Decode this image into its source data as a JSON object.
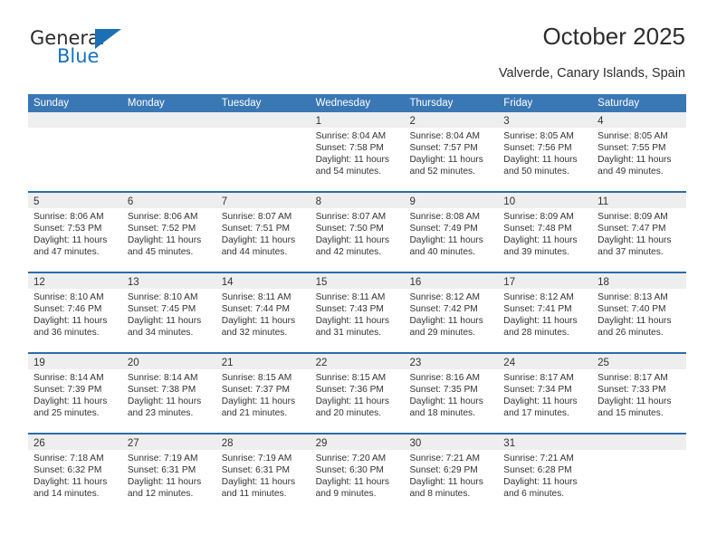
{
  "brand": {
    "name_part1": "General",
    "name_part2": "Blue",
    "flag_icon": "triangle-flag-icon",
    "accent_color": "#1673bb"
  },
  "header": {
    "title": "October 2025",
    "subtitle": "Valverde, Canary Islands, Spain"
  },
  "theme": {
    "header_blue": "#3a77b5",
    "rule_blue": "#2a6cab",
    "daynum_band": "#eeeeee"
  },
  "calendar": {
    "weekdays": [
      "Sunday",
      "Monday",
      "Tuesday",
      "Wednesday",
      "Thursday",
      "Friday",
      "Saturday"
    ],
    "weeks": [
      [
        {
          "day": "",
          "lines": []
        },
        {
          "day": "",
          "lines": []
        },
        {
          "day": "",
          "lines": []
        },
        {
          "day": "1",
          "lines": [
            "Sunrise: 8:04 AM",
            "Sunset: 7:58 PM",
            "Daylight: 11 hours",
            "and 54 minutes."
          ]
        },
        {
          "day": "2",
          "lines": [
            "Sunrise: 8:04 AM",
            "Sunset: 7:57 PM",
            "Daylight: 11 hours",
            "and 52 minutes."
          ]
        },
        {
          "day": "3",
          "lines": [
            "Sunrise: 8:05 AM",
            "Sunset: 7:56 PM",
            "Daylight: 11 hours",
            "and 50 minutes."
          ]
        },
        {
          "day": "4",
          "lines": [
            "Sunrise: 8:05 AM",
            "Sunset: 7:55 PM",
            "Daylight: 11 hours",
            "and 49 minutes."
          ]
        }
      ],
      [
        {
          "day": "5",
          "lines": [
            "Sunrise: 8:06 AM",
            "Sunset: 7:53 PM",
            "Daylight: 11 hours",
            "and 47 minutes."
          ]
        },
        {
          "day": "6",
          "lines": [
            "Sunrise: 8:06 AM",
            "Sunset: 7:52 PM",
            "Daylight: 11 hours",
            "and 45 minutes."
          ]
        },
        {
          "day": "7",
          "lines": [
            "Sunrise: 8:07 AM",
            "Sunset: 7:51 PM",
            "Daylight: 11 hours",
            "and 44 minutes."
          ]
        },
        {
          "day": "8",
          "lines": [
            "Sunrise: 8:07 AM",
            "Sunset: 7:50 PM",
            "Daylight: 11 hours",
            "and 42 minutes."
          ]
        },
        {
          "day": "9",
          "lines": [
            "Sunrise: 8:08 AM",
            "Sunset: 7:49 PM",
            "Daylight: 11 hours",
            "and 40 minutes."
          ]
        },
        {
          "day": "10",
          "lines": [
            "Sunrise: 8:09 AM",
            "Sunset: 7:48 PM",
            "Daylight: 11 hours",
            "and 39 minutes."
          ]
        },
        {
          "day": "11",
          "lines": [
            "Sunrise: 8:09 AM",
            "Sunset: 7:47 PM",
            "Daylight: 11 hours",
            "and 37 minutes."
          ]
        }
      ],
      [
        {
          "day": "12",
          "lines": [
            "Sunrise: 8:10 AM",
            "Sunset: 7:46 PM",
            "Daylight: 11 hours",
            "and 36 minutes."
          ]
        },
        {
          "day": "13",
          "lines": [
            "Sunrise: 8:10 AM",
            "Sunset: 7:45 PM",
            "Daylight: 11 hours",
            "and 34 minutes."
          ]
        },
        {
          "day": "14",
          "lines": [
            "Sunrise: 8:11 AM",
            "Sunset: 7:44 PM",
            "Daylight: 11 hours",
            "and 32 minutes."
          ]
        },
        {
          "day": "15",
          "lines": [
            "Sunrise: 8:11 AM",
            "Sunset: 7:43 PM",
            "Daylight: 11 hours",
            "and 31 minutes."
          ]
        },
        {
          "day": "16",
          "lines": [
            "Sunrise: 8:12 AM",
            "Sunset: 7:42 PM",
            "Daylight: 11 hours",
            "and 29 minutes."
          ]
        },
        {
          "day": "17",
          "lines": [
            "Sunrise: 8:12 AM",
            "Sunset: 7:41 PM",
            "Daylight: 11 hours",
            "and 28 minutes."
          ]
        },
        {
          "day": "18",
          "lines": [
            "Sunrise: 8:13 AM",
            "Sunset: 7:40 PM",
            "Daylight: 11 hours",
            "and 26 minutes."
          ]
        }
      ],
      [
        {
          "day": "19",
          "lines": [
            "Sunrise: 8:14 AM",
            "Sunset: 7:39 PM",
            "Daylight: 11 hours",
            "and 25 minutes."
          ]
        },
        {
          "day": "20",
          "lines": [
            "Sunrise: 8:14 AM",
            "Sunset: 7:38 PM",
            "Daylight: 11 hours",
            "and 23 minutes."
          ]
        },
        {
          "day": "21",
          "lines": [
            "Sunrise: 8:15 AM",
            "Sunset: 7:37 PM",
            "Daylight: 11 hours",
            "and 21 minutes."
          ]
        },
        {
          "day": "22",
          "lines": [
            "Sunrise: 8:15 AM",
            "Sunset: 7:36 PM",
            "Daylight: 11 hours",
            "and 20 minutes."
          ]
        },
        {
          "day": "23",
          "lines": [
            "Sunrise: 8:16 AM",
            "Sunset: 7:35 PM",
            "Daylight: 11 hours",
            "and 18 minutes."
          ]
        },
        {
          "day": "24",
          "lines": [
            "Sunrise: 8:17 AM",
            "Sunset: 7:34 PM",
            "Daylight: 11 hours",
            "and 17 minutes."
          ]
        },
        {
          "day": "25",
          "lines": [
            "Sunrise: 8:17 AM",
            "Sunset: 7:33 PM",
            "Daylight: 11 hours",
            "and 15 minutes."
          ]
        }
      ],
      [
        {
          "day": "26",
          "lines": [
            "Sunrise: 7:18 AM",
            "Sunset: 6:32 PM",
            "Daylight: 11 hours",
            "and 14 minutes."
          ]
        },
        {
          "day": "27",
          "lines": [
            "Sunrise: 7:19 AM",
            "Sunset: 6:31 PM",
            "Daylight: 11 hours",
            "and 12 minutes."
          ]
        },
        {
          "day": "28",
          "lines": [
            "Sunrise: 7:19 AM",
            "Sunset: 6:31 PM",
            "Daylight: 11 hours",
            "and 11 minutes."
          ]
        },
        {
          "day": "29",
          "lines": [
            "Sunrise: 7:20 AM",
            "Sunset: 6:30 PM",
            "Daylight: 11 hours",
            "and 9 minutes."
          ]
        },
        {
          "day": "30",
          "lines": [
            "Sunrise: 7:21 AM",
            "Sunset: 6:29 PM",
            "Daylight: 11 hours",
            "and 8 minutes."
          ]
        },
        {
          "day": "31",
          "lines": [
            "Sunrise: 7:21 AM",
            "Sunset: 6:28 PM",
            "Daylight: 11 hours",
            "and 6 minutes."
          ]
        },
        {
          "day": "",
          "lines": []
        }
      ]
    ]
  }
}
